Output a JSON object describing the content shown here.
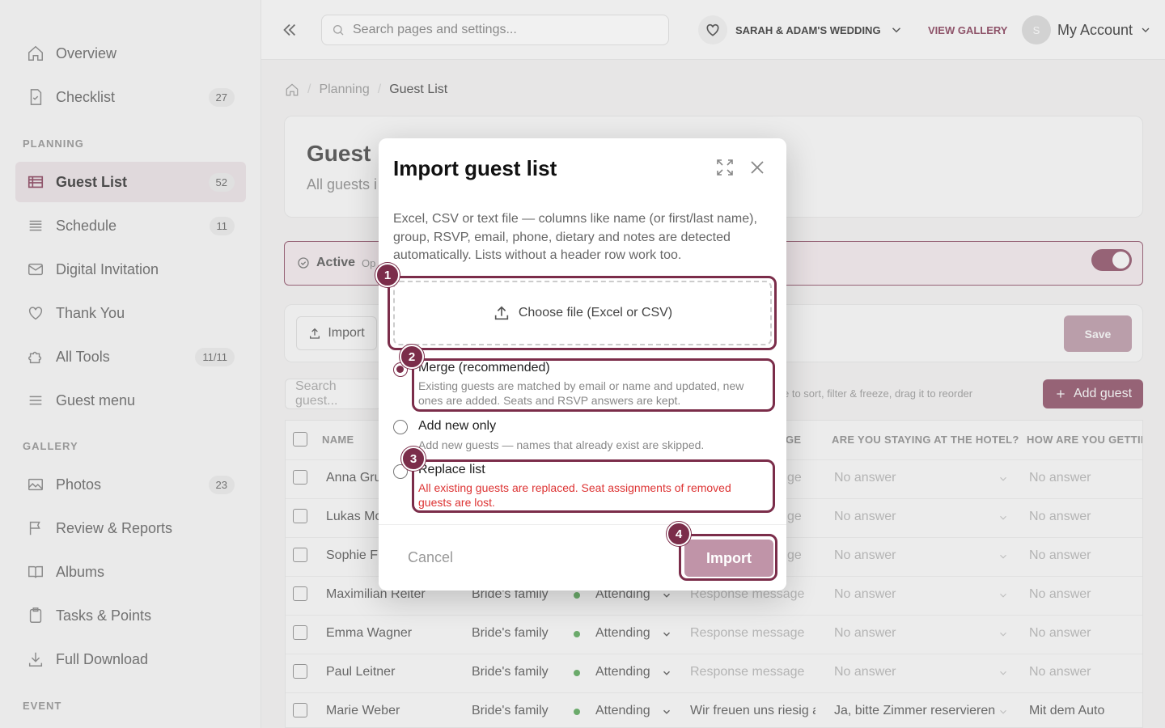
{
  "sidebar": {
    "items": [
      {
        "label": "Overview",
        "icon": "home-icon"
      },
      {
        "label": "Checklist",
        "icon": "checklist-icon",
        "badge": "27"
      },
      {
        "label": "Guest List",
        "icon": "table-icon",
        "badge": "52",
        "active": true
      },
      {
        "label": "Schedule",
        "icon": "list-icon",
        "badge": "11"
      },
      {
        "label": "Digital Invitation",
        "icon": "mail-icon"
      },
      {
        "label": "Thank You",
        "icon": "heart-icon"
      },
      {
        "label": "All Tools",
        "icon": "puzzle-icon",
        "badge": "11/11"
      },
      {
        "label": "Guest menu",
        "icon": "menu-icon"
      },
      {
        "label": "Photos",
        "icon": "photo-icon",
        "badge": "23"
      },
      {
        "label": "Review & Reports",
        "icon": "flag-icon"
      },
      {
        "label": "Albums",
        "icon": "book-icon"
      },
      {
        "label": "Tasks & Points",
        "icon": "clipboard-icon"
      },
      {
        "label": "Full Download",
        "icon": "download-icon"
      }
    ],
    "sections": {
      "planning": "PLANNING",
      "gallery": "GALLERY",
      "event": "EVENT"
    }
  },
  "topbar": {
    "search_placeholder": "Search pages and settings...",
    "wedding_name": "SARAH & ADAM'S WEDDING",
    "view_gallery": "VIEW GALLERY",
    "avatar_initial": "S",
    "account": "My Account"
  },
  "breadcrumb": {
    "section": "Planning",
    "current": "Guest List"
  },
  "page": {
    "title": "Guest L",
    "subtitle": "All guests i",
    "active_label": "Active",
    "active_extra": "Op",
    "import_label": "Import",
    "save_label": "Save",
    "guest_search_placeholder": "Search guest...",
    "hint": "e to sort, filter & freeze, drag it to reorder",
    "add_guest": "Add guest"
  },
  "table": {
    "headers": {
      "name": "NAME",
      "message_tail": "GE",
      "hotel": "ARE YOU STAYING AT THE HOTEL?",
      "getting": "HOW ARE YOU GETTIN"
    },
    "rows": [
      {
        "name": "Anna Gru",
        "group": "",
        "rsvp": "",
        "message": "ge",
        "hotel": "No answer",
        "getting": "No answer"
      },
      {
        "name": "Lukas Mo",
        "group": "",
        "rsvp": "",
        "message": "ge",
        "hotel": "No answer",
        "getting": "No answer"
      },
      {
        "name": "Sophie Fi",
        "group": "",
        "rsvp": "",
        "message": "ge",
        "hotel": "No answer",
        "getting": "No answer"
      },
      {
        "name": "Maximilian Reiter",
        "group": "Bride's family",
        "rsvp": "Attending",
        "message": "Response message",
        "hotel": "No answer",
        "getting": "No answer"
      },
      {
        "name": "Emma Wagner",
        "group": "Bride's family",
        "rsvp": "Attending",
        "message": "Response message",
        "hotel": "No answer",
        "getting": "No answer"
      },
      {
        "name": "Paul Leitner",
        "group": "Bride's family",
        "rsvp": "Attending",
        "message": "Response message",
        "hotel": "No answer",
        "getting": "No answer"
      },
      {
        "name": "Marie Weber",
        "group": "Bride's family",
        "rsvp": "Attending",
        "message": "Wir freuen uns riesig a",
        "hotel": "Ja, bitte Zimmer reservieren",
        "getting": "Mit dem Auto"
      }
    ]
  },
  "modal": {
    "title": "Import guest list",
    "description": "Excel, CSV or text file — columns like name (or first/last name), group, RSVP, email, phone, dietary and notes are detected automatically. Lists without a header row work too.",
    "dropzone": "Choose file (Excel or CSV)",
    "options": [
      {
        "title": "Merge (recommended)",
        "desc": "Existing guests are matched by email or name and updated, new ones are added. Seats and RSVP answers are kept.",
        "selected": true
      },
      {
        "title": "Add new only",
        "desc": "Add new guests — names that already exist are skipped.",
        "selected": false
      },
      {
        "title": "Replace list",
        "desc": "All existing guests are replaced. Seat assignments of removed guests are lost.",
        "selected": false
      }
    ],
    "cancel": "Cancel",
    "import": "Import"
  },
  "annotations": [
    "1",
    "2",
    "3",
    "4"
  ],
  "colors": {
    "accent": "#7b2d4a",
    "accent_light": "#c094a8",
    "warn": "#dd3333",
    "attending": "#3a9a3a"
  }
}
